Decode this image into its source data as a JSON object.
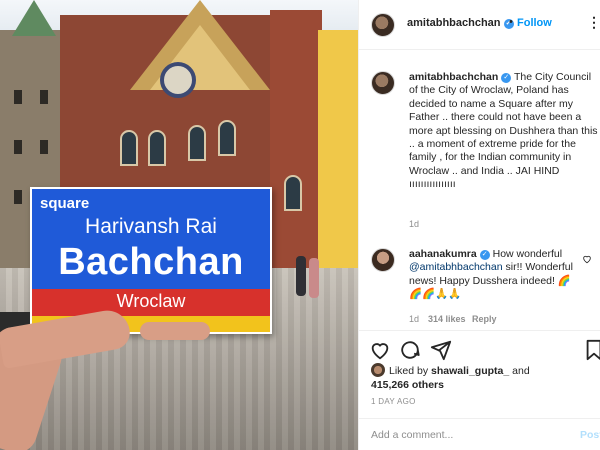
{
  "photo": {
    "sign": {
      "small_label": "square",
      "line1": "Harivansh Rai",
      "line2": "Bachchan",
      "city": "Wroclaw"
    }
  },
  "post": {
    "author": "amitabhbachchan",
    "follow_label": "Follow",
    "separator": "•",
    "more_label": "⋮",
    "caption": {
      "author": "amitabhbachchan",
      "text": "The City Council of the City of Wroclaw, Poland has decided to name a Square after my Father .. there could not have been a more apt blessing on Dushhera than this .. a moment of extreme pride for the family , for the Indian community in Wroclaw .. and India .. JAI HIND ıııııııııııııııı",
      "time": "1d"
    },
    "comment": {
      "author": "aahanakumra",
      "text_before": "How wonderful",
      "mention": "@amitabhbachchan",
      "text_after": "sir!! Wonderful news! Happy Dusshera indeed! 🌈🌈🌈🙏🙏",
      "time": "1d",
      "likes": "314 likes",
      "reply_label": "Reply"
    },
    "liked_by": {
      "prefix": "Liked by",
      "user": "shawali_gupta_",
      "conj": "and",
      "others": "415,266 others"
    },
    "ago": "1 DAY AGO",
    "add_comment_placeholder": "Add a comment...",
    "post_label": "Post"
  },
  "icons": [
    "heart-icon",
    "comment-icon",
    "share-icon",
    "bookmark-icon",
    "verified-icon",
    "more-icon"
  ],
  "colors": {
    "link": "#0095f6",
    "mention": "#00376b",
    "muted": "#8e8e8e",
    "verified": "#3897f0"
  }
}
